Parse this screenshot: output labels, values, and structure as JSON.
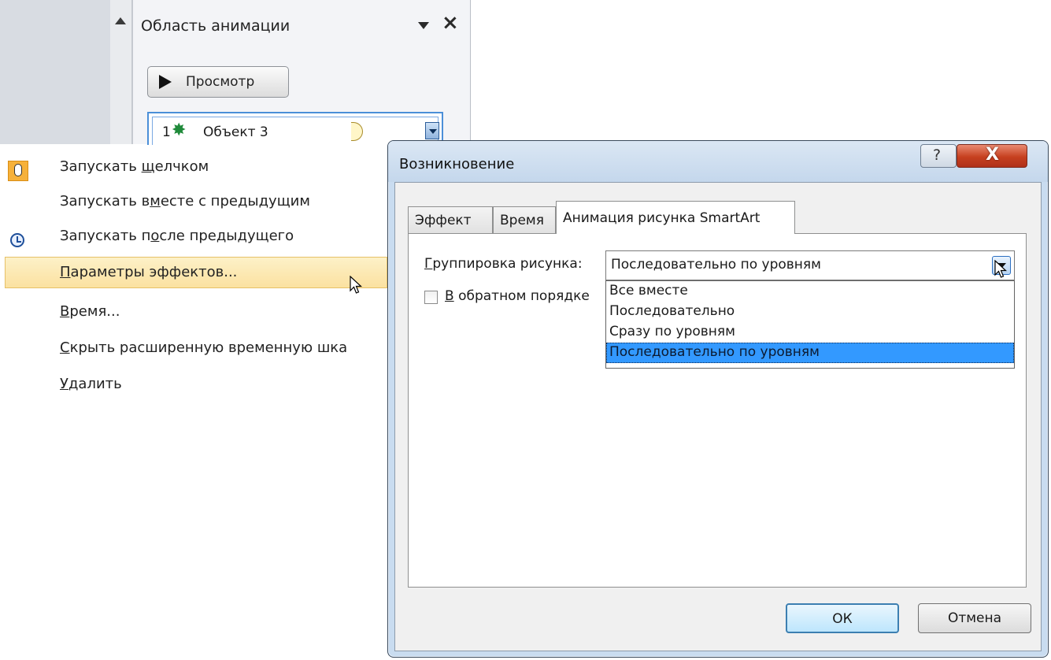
{
  "animation_pane": {
    "title": "Область анимации",
    "preview_label": "Просмотр",
    "item": {
      "number": "1",
      "name": "Объект 3"
    }
  },
  "context_menu": {
    "items": [
      {
        "label": "Запускать щелчком",
        "icon": "mouse-click-icon"
      },
      {
        "label": "Запускать вместе с предыдущим"
      },
      {
        "label": "Запускать после предыдущего",
        "icon": "clock-icon"
      },
      {
        "label": "Параметры эффектов...",
        "highlighted": true
      },
      {
        "label": "Время..."
      },
      {
        "label": "Скрыть расширенную временную шка"
      },
      {
        "label": "Удалить"
      }
    ]
  },
  "dialog": {
    "title": "Возникновение",
    "help_glyph": "?",
    "close_glyph": "X",
    "tabs": [
      "Эффект",
      "Время",
      "Анимация рисунка SmartArt"
    ],
    "active_tab": "Анимация рисунка SmartArt",
    "group_label": "Группировка рисунка:",
    "group_value": "Последовательно по уровням",
    "checkbox_label": "В обратном порядке",
    "options": [
      "Все вместе",
      "Последовательно",
      "Сразу по уровням",
      "Последовательно по уровням"
    ],
    "selected_option": "Последовательно по уровням",
    "ok_label": "ОК",
    "cancel_label": "Отмена"
  },
  "colors": {
    "menu_highlight": "#fbe1a0",
    "selection_blue": "#3399ff",
    "close_red": "#c6401f"
  }
}
